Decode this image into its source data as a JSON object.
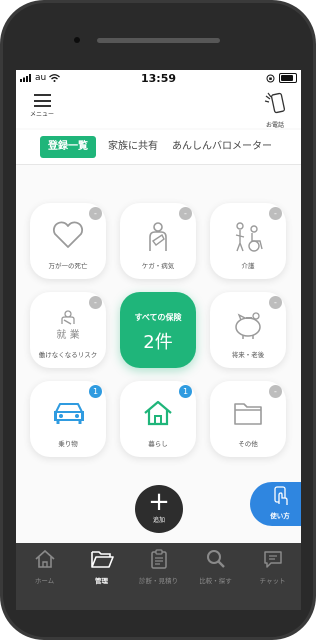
{
  "status_bar": {
    "carrier": "au",
    "time": "13:59"
  },
  "header": {
    "menu_label": "メニュー",
    "phone_label": "お電話"
  },
  "tabs": [
    {
      "label": "登録一覧",
      "active": true
    },
    {
      "label": "家族に共有",
      "active": false
    },
    {
      "label": "あんしんバロメーター",
      "active": false
    }
  ],
  "categories": [
    {
      "label": "万が一の死亡",
      "badge": "-",
      "icon": "heart-icon"
    },
    {
      "label": "ケガ・病気",
      "badge": "-",
      "icon": "injured-person-icon"
    },
    {
      "label": "介護",
      "badge": "-",
      "icon": "wheelchair-icon"
    },
    {
      "label": "働けなくなるリスク",
      "badge": "-",
      "icon": "work-icon",
      "icon_text": "就 業"
    },
    {
      "label": "将来・老後",
      "badge": "-",
      "icon": "piggy-bank-icon"
    },
    {
      "label": "乗り物",
      "badge": "1",
      "icon": "car-icon"
    },
    {
      "label": "暮らし",
      "badge": "1",
      "icon": "house-icon"
    },
    {
      "label": "その他",
      "badge": "-",
      "icon": "folder-icon"
    }
  ],
  "all_insurance": {
    "title": "すべての保険",
    "count": "2件"
  },
  "add_button": {
    "label": "追加"
  },
  "usage_button": {
    "label": "使い方"
  },
  "tabbar": [
    {
      "label": "ホーム",
      "icon": "home-icon",
      "active": false
    },
    {
      "label": "管理",
      "icon": "folder-open-icon",
      "active": true
    },
    {
      "label": "診断・見積り",
      "icon": "clipboard-icon",
      "active": false
    },
    {
      "label": "比較・探す",
      "icon": "search-icon",
      "active": false
    },
    {
      "label": "チャット",
      "icon": "chat-icon",
      "active": false
    }
  ],
  "colors": {
    "accent": "#1fb57a",
    "badge_active": "#2f9be0",
    "badge_inactive": "#bdbdbd",
    "tabbar": "#3b3b3b",
    "usage": "#2f86e0"
  }
}
